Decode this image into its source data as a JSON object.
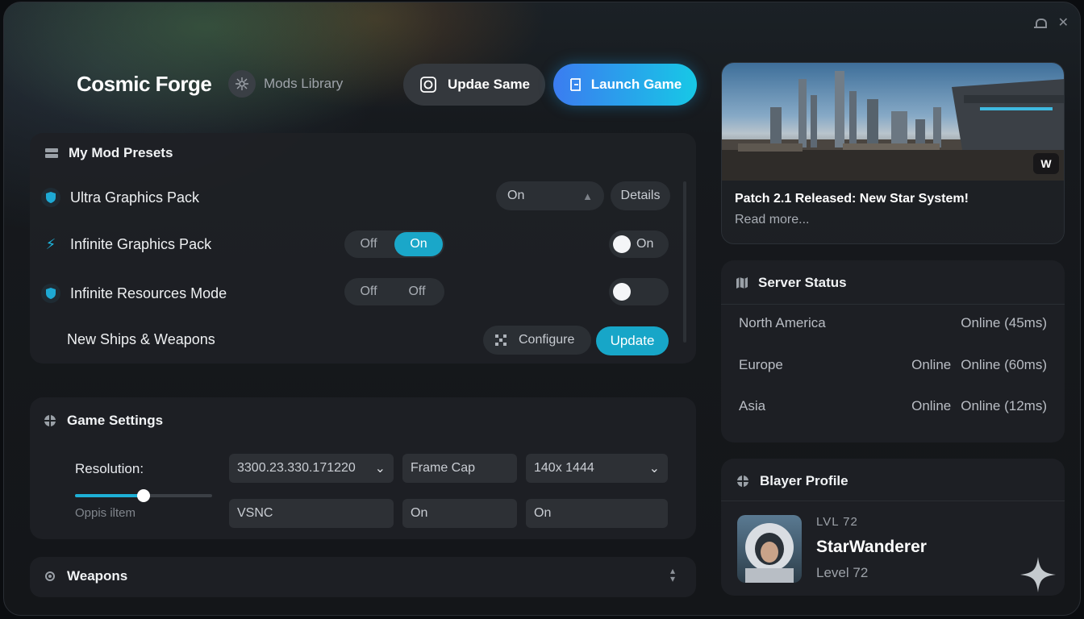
{
  "window": {
    "controls": [
      "bell",
      "close"
    ]
  },
  "header": {
    "app_title": "Cosmic Forge",
    "library_label": "Mods Library",
    "update_button": "Updae Same",
    "launch_button": "Launch Game"
  },
  "presets": {
    "title": "My Mod Presets",
    "rows": [
      {
        "label": "Ultra Graphics Pack",
        "state": "On",
        "details": "Details"
      },
      {
        "label": "Infinite Graphics Pack",
        "seg_off": "Off",
        "seg_on": "On",
        "toggle_label": "On"
      },
      {
        "label": "Infinite Resources Mode",
        "seg_off": "Off",
        "seg_on": "Off"
      },
      {
        "label": "New Ships & Weapons",
        "configure": "Configure",
        "update": "Update"
      }
    ]
  },
  "settings": {
    "title": "Game Settings",
    "resolution_label": "Resolution:",
    "resolution_value": "3300.23.330.171220",
    "frame_cap_label": "Frame Cap",
    "frame_cap_value": "140x 1444",
    "slider_caption": "Oppis iltem",
    "slider_level": 0.5,
    "vsync_label": "VSNC",
    "vsync_value": "On",
    "vsync_value2": "On"
  },
  "weapons": {
    "title": "Weapons"
  },
  "news": {
    "title": "Patch 2.1 Released: New Star System!",
    "read_more": "Read more...",
    "logo": "W"
  },
  "server_status": {
    "title": "Server Status",
    "rows": [
      {
        "region": "North America",
        "status": "",
        "detail": "Online (45ms)"
      },
      {
        "region": "Europe",
        "status": "Online",
        "detail": "Online (60ms)"
      },
      {
        "region": "Asia",
        "status": "Online",
        "detail": "Online (12ms)"
      }
    ]
  },
  "profile": {
    "title": "Blayer Profile",
    "level_tag": "LVL 72",
    "name": "StarWanderer",
    "level": "Level 72"
  },
  "colors": {
    "accent": "#17a6c8",
    "primary_gradient_start": "#3b7cf0",
    "primary_gradient_end": "#17c8e6"
  }
}
